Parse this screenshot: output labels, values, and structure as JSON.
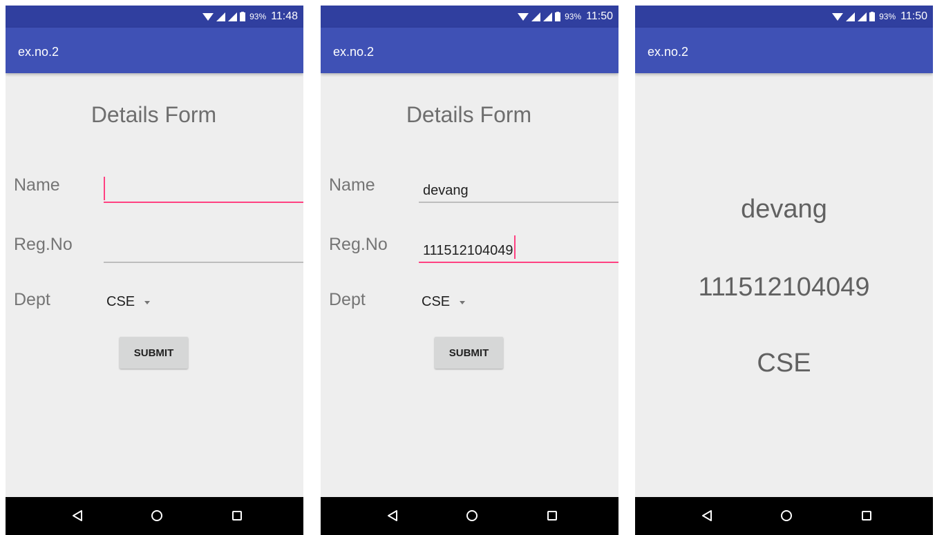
{
  "screens": [
    {
      "status": {
        "battery": "93%",
        "time": "11:48"
      },
      "app_title": "ex.no.2",
      "form_title": "Details Form",
      "fields": {
        "name_label": "Name",
        "name_value": "",
        "regno_label": "Reg.No",
        "regno_value": "",
        "dept_label": "Dept",
        "dept_value": "CSE"
      },
      "submit_label": "SUBMIT"
    },
    {
      "status": {
        "battery": "93%",
        "time": "11:50"
      },
      "app_title": "ex.no.2",
      "form_title": "Details Form",
      "fields": {
        "name_label": "Name",
        "name_value": "devang",
        "regno_label": "Reg.No",
        "regno_value": "111512104049",
        "dept_label": "Dept",
        "dept_value": "CSE"
      },
      "submit_label": "SUBMIT"
    },
    {
      "status": {
        "battery": "93%",
        "time": "11:50"
      },
      "app_title": "ex.no.2",
      "result": {
        "name": "devang",
        "regno": "111512104049",
        "dept": "CSE"
      }
    }
  ],
  "icons": {
    "status": [
      "wifi-icon",
      "signal-icon",
      "signal-icon",
      "battery-icon"
    ],
    "nav": [
      "back-icon",
      "home-icon",
      "recent-apps-icon"
    ]
  },
  "colors": {
    "status_bar": "#303f9f",
    "app_bar": "#3f51b5",
    "accent": "#ff4081",
    "background": "#eeeeee",
    "nav_bar": "#000000"
  }
}
